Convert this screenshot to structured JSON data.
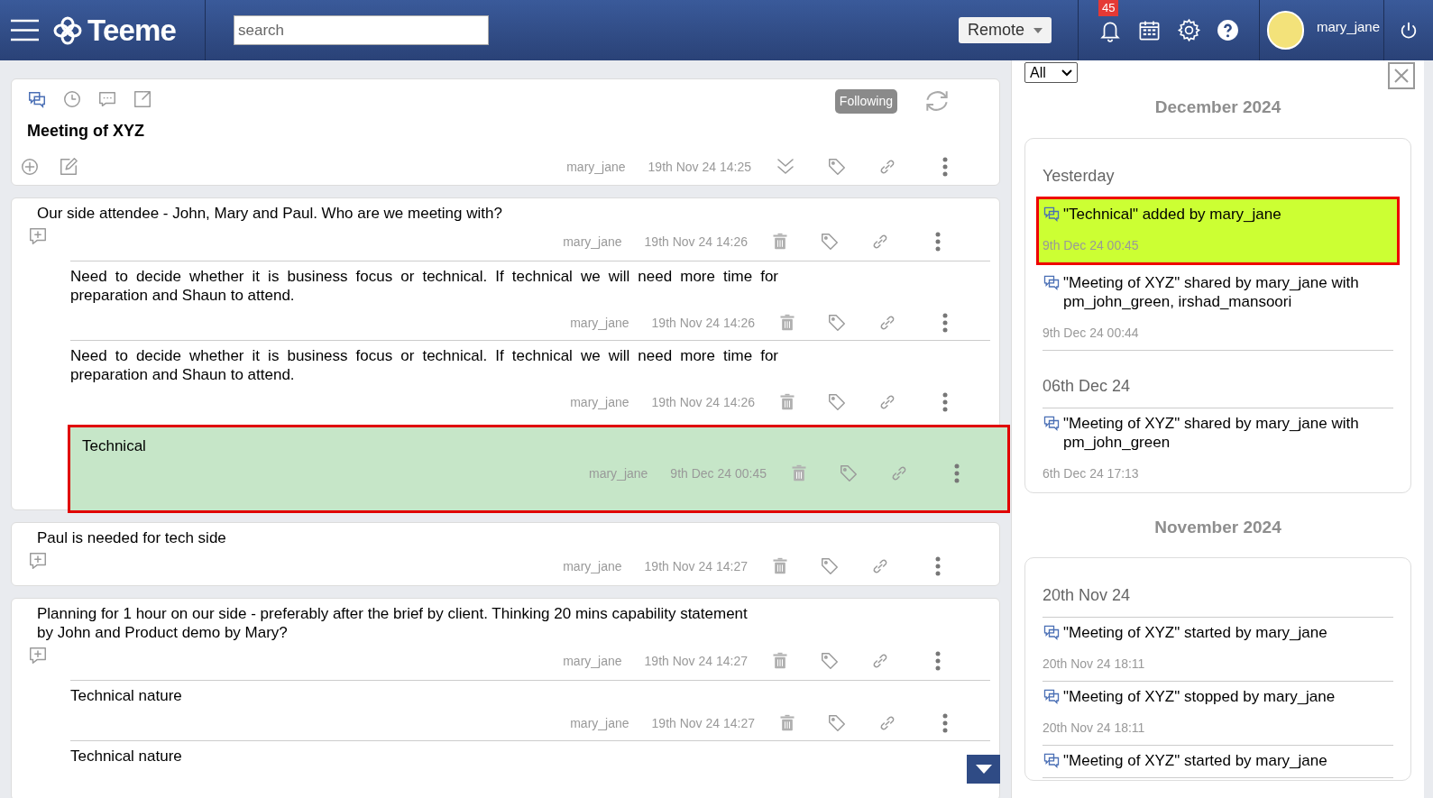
{
  "header": {
    "app_name": "Teeme",
    "search": {
      "placeholder": "search"
    },
    "mode": "Remote",
    "notification_count": "45",
    "username": "mary_jane"
  },
  "topic": {
    "title": "Meeting of XYZ",
    "follow_label": "Following",
    "author": "mary_jane",
    "time": "19th Nov 24 14:25"
  },
  "posts": [
    {
      "text": "Our side attendee - John, Mary and Paul. Who are we meeting with?",
      "author": "mary_jane",
      "time": "19th Nov 24 14:26",
      "children": [
        {
          "text": "Need to decide whether it is business focus or technical. If technical we will need more time for preparation and Shaun to attend.",
          "author": "mary_jane",
          "time": "19th Nov 24 14:26",
          "selected": false
        },
        {
          "text": "Need to decide whether it is business focus or technical. If technical we will need more time for preparation and Shaun to attend.",
          "author": "mary_jane",
          "time": "19th Nov 24 14:26",
          "selected": false
        },
        {
          "text": "Technical",
          "author": "mary_jane",
          "time": "9th Dec 24 00:45",
          "selected": true
        }
      ]
    },
    {
      "text": "Paul is needed for tech side",
      "author": "mary_jane",
      "time": "19th Nov 24 14:27"
    },
    {
      "text": "Planning for 1 hour on our side - preferably after the brief by client. Thinking 20 mins capability statement by John and Product demo by Mary?",
      "author": "mary_jane",
      "time": "19th Nov 24 14:27",
      "children": [
        {
          "text": "Technical nature",
          "author": "mary_jane",
          "time": "19th Nov 24 14:27",
          "selected": false
        },
        {
          "text": "Technical nature",
          "selected": false
        }
      ]
    }
  ],
  "activity": {
    "filter": "All",
    "months": [
      {
        "month": "December 2024",
        "days": [
          {
            "label": "Yesterday",
            "items": [
              {
                "text": "\"Technical\" added by mary_jane",
                "time": "9th Dec 24 00:45",
                "selected": true
              },
              {
                "text": "\"Meeting of XYZ\" shared by mary_jane with pm_john_green, irshad_mansoori",
                "time": "9th Dec 24 00:44",
                "selected": false
              }
            ]
          },
          {
            "label": "06th Dec 24",
            "items": [
              {
                "text": "\"Meeting of XYZ\" shared by mary_jane with pm_john_green",
                "time": "6th Dec 24 17:13",
                "selected": false
              }
            ]
          }
        ]
      },
      {
        "month": "November 2024",
        "days": [
          {
            "label": "20th Nov 24",
            "items": [
              {
                "text": "\"Meeting of XYZ\" started by mary_jane",
                "time": "20th Nov 24 18:11",
                "selected": false
              },
              {
                "text": "\"Meeting of XYZ\" stopped by mary_jane",
                "time": "20th Nov 24 18:11",
                "selected": false
              },
              {
                "text": "\"Meeting of XYZ\" started by mary_jane",
                "selected": false
              }
            ]
          }
        ]
      }
    ]
  }
}
